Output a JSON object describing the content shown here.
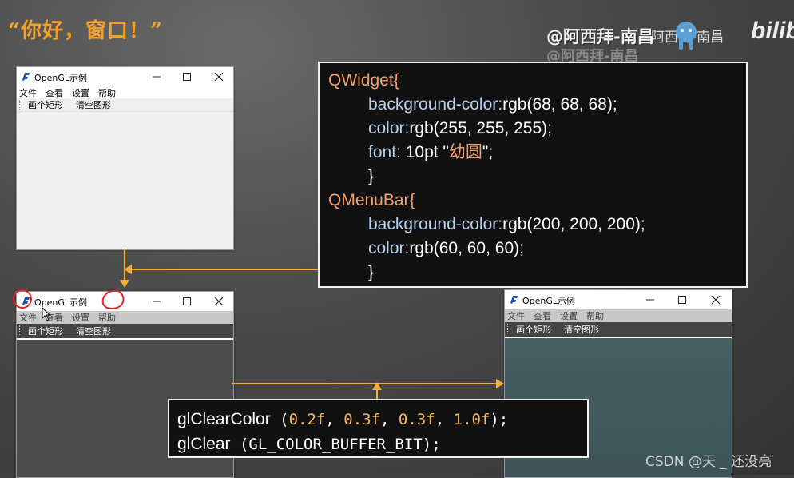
{
  "slide": {
    "title": "“你好，窗口！”",
    "watermark": "@阿西拜-南昌",
    "watermark_shadow": "@阿西拜-南昌",
    "bili_tag": "阿西拜-南昌",
    "bili_logo": "bilib",
    "csdn_credit": "CSDN @天 _ 还没亮",
    "accent_color": "#f2a22c"
  },
  "windows": [
    {
      "title": "OpenGL示例",
      "menus": [
        "文件",
        "查看",
        "设置",
        "帮助"
      ],
      "toolbar": [
        "画个矩形",
        "清空图形"
      ],
      "theme": "default",
      "canvas_color": "#f0f0f0"
    },
    {
      "title": "OpenGL示例",
      "menus": [
        "文件",
        "查看",
        "设置",
        "帮助"
      ],
      "toolbar": [
        "画个矩形",
        "清空图形"
      ],
      "theme": "styled",
      "canvas_color": "#444444"
    },
    {
      "title": "OpenGL示例",
      "menus": [
        "文件",
        "查看",
        "设置",
        "帮助"
      ],
      "toolbar": [
        "画个矩形",
        "清空图形"
      ],
      "theme": "styled",
      "canvas_color": "#3f5a5c"
    }
  ],
  "stylesheet_code": {
    "qwidget_selector": "QWidget{",
    "bg_prop": "background-color:",
    "bg_val": "rgb(68, 68, 68);",
    "color_prop": "color:",
    "color_val": "rgb(255, 255, 255);",
    "font_prop": "font:",
    "font_val_pre": " 10pt \"",
    "font_name": "幼圆",
    "font_val_post": "\";",
    "close1": "}",
    "qmenubar_selector": "QMenuBar{",
    "mb_bg_prop": "background-color:",
    "mb_bg_val": "rgb(200, 200, 200);",
    "mb_color_prop": "color:",
    "mb_color_val": "rgb(60, 60, 60);",
    "close2": "}"
  },
  "gl_code": {
    "fn1": "glClearColor",
    "paren_open": " (",
    "n1": "0.2f",
    "sep": ", ",
    "n2": "0.3f",
    "n3": "0.3f",
    "n4": "1.0f",
    "paren_close1": ");",
    "fn2": "glClear",
    "arg2": " (GL_COLOR_BUFFER_BIT);"
  },
  "titlebar_controls": [
    "minimize",
    "maximize",
    "close"
  ],
  "icon_names": [
    "qt-app-icon",
    "minimize-icon",
    "maximize-icon",
    "close-icon",
    "toolbar-grip-icon",
    "annotation-circle-icon",
    "mouse-cursor-icon"
  ]
}
